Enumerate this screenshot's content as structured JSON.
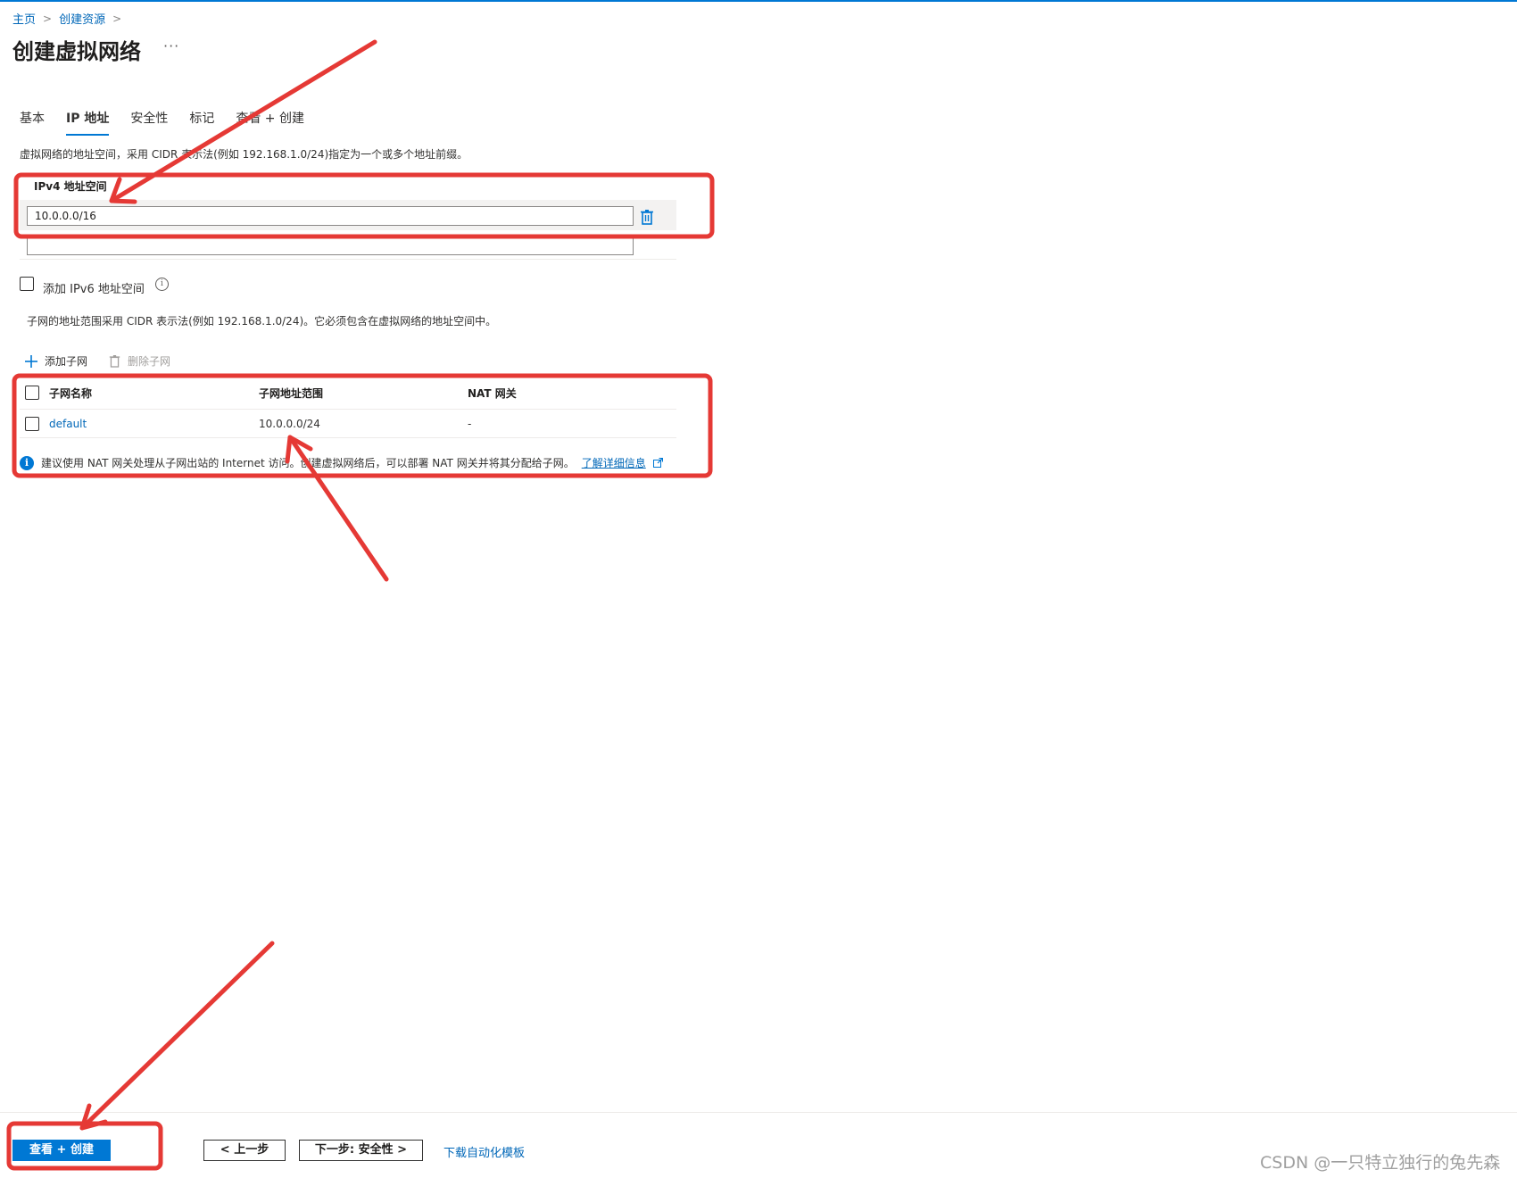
{
  "breadcrumb": {
    "home": "主页",
    "create": "创建资源"
  },
  "page_title": "创建虚拟网络",
  "more_label": "···",
  "tabs": [
    {
      "label": "基本"
    },
    {
      "label": "IP 地址"
    },
    {
      "label": "安全性"
    },
    {
      "label": "标记"
    },
    {
      "label": "查看 + 创建"
    }
  ],
  "address_space": {
    "description": "虚拟网络的地址空间，采用 CIDR 表示法(例如 192.168.1.0/24)指定为一个或多个地址前缀。",
    "ipv4_label": "IPv4 地址空间",
    "ipv4_value": "10.0.0.0/16",
    "ipv4_new_value": ""
  },
  "ipv6": {
    "label": "添加 IPv6 地址空间",
    "checked": false
  },
  "subnets": {
    "description": "子网的地址范围采用 CIDR 表示法(例如 192.168.1.0/24)。它必须包含在虚拟网络的地址空间中。",
    "add_label": "添加子网",
    "delete_label": "删除子网",
    "headers": {
      "name": "子网名称",
      "range": "子网地址范围",
      "nat": "NAT 网关"
    },
    "rows": [
      {
        "name": "default",
        "range": "10.0.0.0/24",
        "nat": "-"
      }
    ]
  },
  "info_banner": {
    "text": "建议使用 NAT 网关处理从子网出站的 Internet 访问。创建虚拟网络后，可以部署 NAT 网关并将其分配给子网。",
    "link": "了解详细信息"
  },
  "footer": {
    "review_create": "查看 + 创建",
    "previous": "< 上一步",
    "next": "下一步: 安全性 >",
    "download": "下载自动化模板"
  },
  "watermark": "CSDN @一只特立独行的兔先森",
  "colors": {
    "accent": "#0078d4",
    "annotation": "#e53935"
  }
}
